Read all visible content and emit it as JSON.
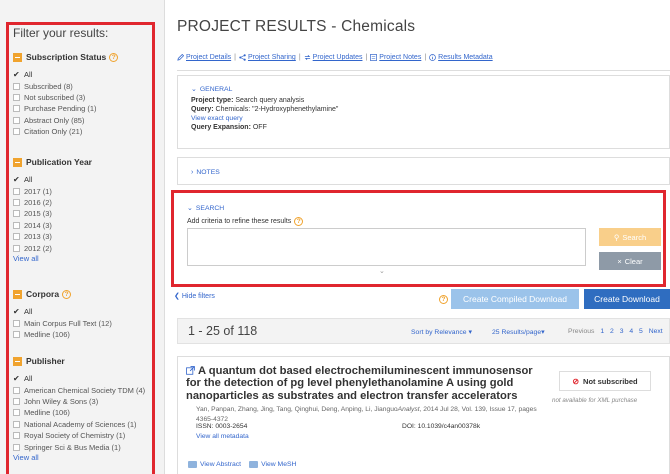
{
  "sidebar": {
    "title": "Filter your results:",
    "groups": [
      {
        "title": "Subscription Status",
        "has_help": true,
        "items": [
          {
            "label": "All",
            "checked": true
          },
          {
            "label": "Subscribed (8)",
            "checked": false
          },
          {
            "label": "Not subscribed (3)",
            "checked": false
          },
          {
            "label": "Purchase Pending (1)",
            "checked": false
          },
          {
            "label": "Abstract Only (85)",
            "checked": false
          },
          {
            "label": "Citation Only (21)",
            "checked": false
          }
        ],
        "view_all": ""
      },
      {
        "title": "Publication Year",
        "has_help": false,
        "items": [
          {
            "label": "All",
            "checked": true
          },
          {
            "label": "2017 (1)",
            "checked": false
          },
          {
            "label": "2016 (2)",
            "checked": false
          },
          {
            "label": "2015 (3)",
            "checked": false
          },
          {
            "label": "2014 (3)",
            "checked": false
          },
          {
            "label": "2013 (3)",
            "checked": false
          },
          {
            "label": "2012 (2)",
            "checked": false
          }
        ],
        "view_all": "View all"
      },
      {
        "title": "Corpora",
        "has_help": true,
        "items": [
          {
            "label": "All",
            "checked": true
          },
          {
            "label": "Main Corpus Full Text (12)",
            "checked": false
          },
          {
            "label": "Medline (106)",
            "checked": false
          }
        ],
        "view_all": ""
      },
      {
        "title": "Publisher",
        "has_help": false,
        "items": [
          {
            "label": "All",
            "checked": true
          },
          {
            "label": "American Chemical Society TDM (4)",
            "checked": false
          },
          {
            "label": "John Wiley & Sons (3)",
            "checked": false
          },
          {
            "label": "Medline (106)",
            "checked": false
          },
          {
            "label": "National Academy of Sciences (1)",
            "checked": false
          },
          {
            "label": "Royal Society of Chemistry (1)",
            "checked": false
          },
          {
            "label": "Springer Sci & Bus Media (1)",
            "checked": false
          }
        ],
        "view_all": "View all"
      }
    ]
  },
  "page": {
    "title": "PROJECT RESULTS - Chemicals",
    "tabs": [
      "Project Details",
      "Project Sharing",
      "Project Updates",
      "Project Notes",
      "Results Metadata"
    ]
  },
  "general": {
    "label": "GENERAL",
    "project_type_label": "Project type:",
    "project_type": "Search query analysis",
    "query_label": "Query:",
    "query": "Chemicals: \"2-Hydroxyphenethylamine\"",
    "view_exact": "View exact query",
    "expansion_label": "Query Expansion:",
    "expansion": "OFF"
  },
  "notes": {
    "label": "NOTES"
  },
  "search": {
    "label": "SEARCH",
    "hint": "Add criteria to refine these results",
    "search_button": "Search",
    "clear_button": "Clear"
  },
  "toolbar": {
    "hide_filters": "Hide filters",
    "compiled_download": "Create Compiled Download",
    "create_download": "Create Download"
  },
  "results": {
    "count": "1 - 25 of 118",
    "sort": "Sort by Relevance",
    "per_page": "25 Results/page",
    "previous": "Previous",
    "pages": [
      "1",
      "2",
      "3",
      "4",
      "5"
    ],
    "next": "Next"
  },
  "record": {
    "title": "A quantum dot based electrochemiluminescent immunosensor for the detection of pg level phenylethanolamine A using gold nanoparticles as substrates and electron transfer accelerators",
    "authors": "Yan, Panpan, Zhang, Jing, Tang, Qinghui, Deng, Anping, Li, Jianguo",
    "journal": "Analyst",
    "pub": ", 2014 Jul 28, Vol. 139, Issue 17, pages 4365-4372",
    "issn": "ISSN: 0003-2654",
    "doi": "DOI: 10.1039/c4an00378k",
    "view_metadata": "View all metadata",
    "status": "Not subscribed",
    "status_note": "not available for XML purchase",
    "view_abstract": "View Abstract",
    "view_mesh": "View MeSH"
  },
  "colors": {
    "highlight": "#e0262e",
    "accent_orange": "#f0a32e",
    "link": "#3366cc",
    "primary_button": "#2f6dc0"
  }
}
